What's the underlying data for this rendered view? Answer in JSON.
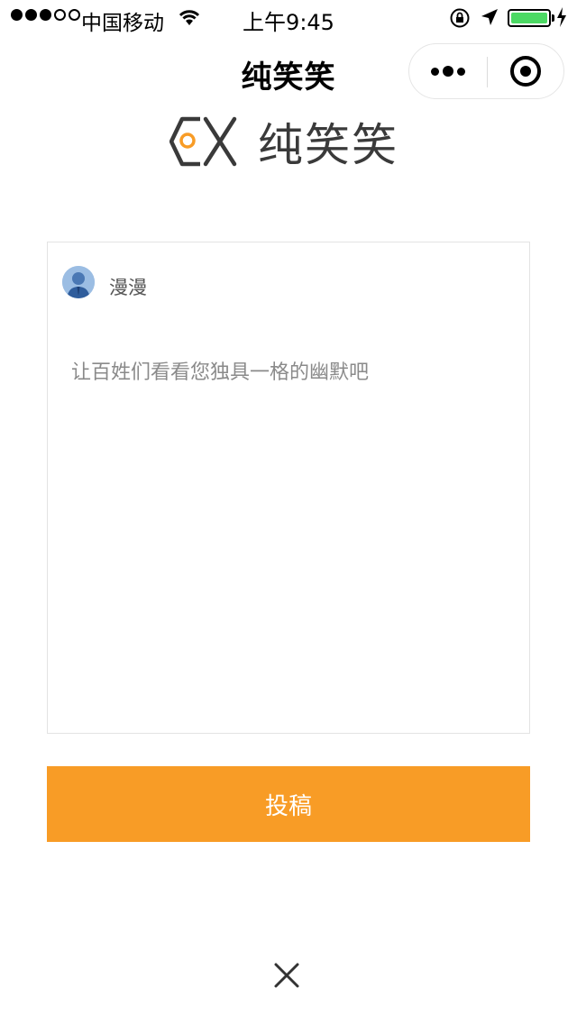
{
  "status_bar": {
    "carrier": "中国移动",
    "time": "上午9:45",
    "signal_bars_full": 3,
    "signal_bars_total": 5,
    "battery_level": 1.0,
    "battery_color": "#4cd964"
  },
  "nav": {
    "title": "纯笑笑",
    "menu_icon": "more-dots-icon",
    "close_icon": "close-target-icon"
  },
  "logo": {
    "text": "纯笑笑",
    "accent": "#f89c26"
  },
  "composer": {
    "username": "漫漫",
    "placeholder": "让百姓们看看您独具一格的幽默吧",
    "value": ""
  },
  "submit": {
    "label": "投稿",
    "color": "#f89c26"
  },
  "footer": {
    "close_icon": "close-x-icon"
  }
}
